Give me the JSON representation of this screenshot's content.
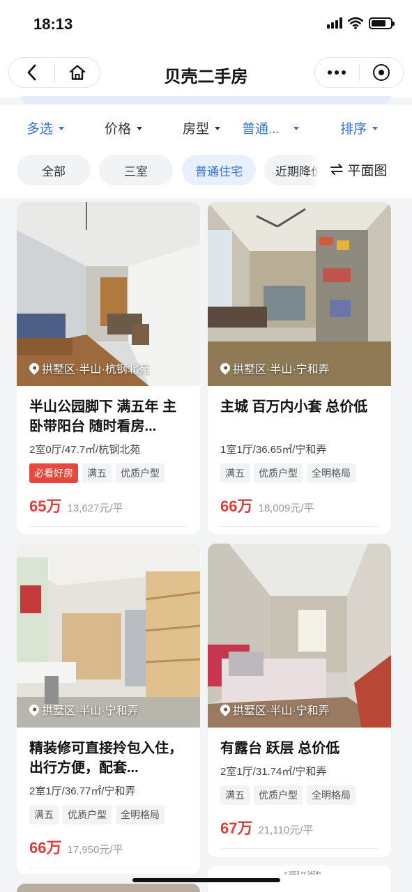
{
  "status_bar": {
    "time": "18:13",
    "battery_level": 0.75
  },
  "nav": {
    "title": "贝壳二手房"
  },
  "filters": [
    {
      "label": "多选",
      "active": true
    },
    {
      "label": "价格",
      "active": false
    },
    {
      "label": "房型",
      "active": false
    },
    {
      "label": "普通...",
      "active": true
    },
    {
      "label": "排序",
      "active": true
    }
  ],
  "chips": [
    {
      "label": "全部",
      "active": false
    },
    {
      "label": "三室",
      "active": false
    },
    {
      "label": "普通住宅",
      "active": true
    },
    {
      "label": "近期降价",
      "active": false
    }
  ],
  "floor_plan_label": "平面图",
  "listings": [
    {
      "location": "拱墅区·半山·杭钢北苑",
      "title": "半山公园脚下 满五年 主卧带阳台 随时看房...",
      "info": "2室0厅/47.7㎡/杭钢北苑",
      "tags": [
        "必看好房",
        "满五",
        "优质户型"
      ],
      "price": "65万",
      "unit_price": "13,627元/平"
    },
    {
      "location": "拱墅区·半山·宁和弄",
      "title": "主城 百万内小套 总价低",
      "info": "1室1厅/36.65㎡/宁和弄",
      "tags": [
        "满五",
        "优质户型",
        "全明格局"
      ],
      "price": "66万",
      "unit_price": "18,009元/平"
    },
    {
      "location": "拱墅区·半山·宁和弄",
      "title": "精装修可直接拎包入住，出行方便，配套...",
      "info": "2室1厅/36.77㎡/宁和弄",
      "tags": [
        "满五",
        "优质户型",
        "全明格局"
      ],
      "price": "66万",
      "unit_price": "17,950元/平"
    },
    {
      "location": "拱墅区·半山·宁和弄",
      "title": "有露台 跃层 总价低",
      "info": "2室1厅/31.74㎡/宁和弄",
      "tags": [
        "满五",
        "优质户型",
        "全明格局"
      ],
      "price": "67万",
      "unit_price": "21,110元/平"
    }
  ],
  "next_card_watermark": "e 1823 ×v 1424×",
  "colors": {
    "accent": "#3472e0",
    "price": "#e03c3c",
    "hot_tag": "#e8473d"
  }
}
